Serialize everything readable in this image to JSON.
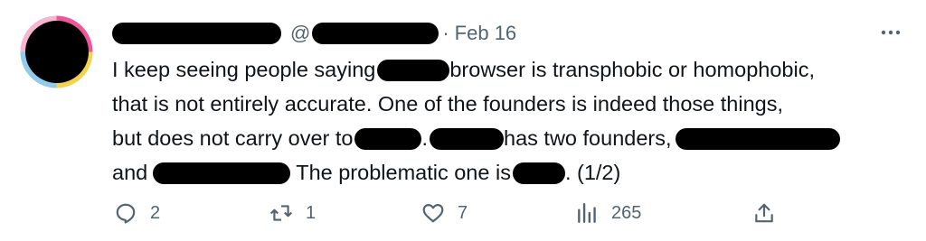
{
  "tweet": {
    "handle_prefix": "@",
    "separator": "·",
    "date": "Feb 16",
    "text": {
      "line1_a": "I keep seeing people saying",
      "line1_b": "browser is transphobic or homophobic,",
      "line2": "that is not entirely accurate. One of the founders is indeed those things,",
      "line3_a": "but does not carry over to",
      "line3_b": ".",
      "line3_c": "has two founders,",
      "line4_a": "and",
      "line4_b": "The problematic one is",
      "line4_c": ". (1/2)"
    }
  },
  "actions": {
    "replies": "2",
    "reposts": "1",
    "likes": "7",
    "views": "265"
  },
  "icons": {
    "more": "more-horizontal-icon",
    "reply": "reply-icon",
    "repost": "repost-icon",
    "like": "heart-icon",
    "views": "views-icon",
    "share": "share-icon"
  },
  "colors": {
    "text": "#0f1419",
    "muted": "#536471",
    "avatar_ring": [
      "#f0559b",
      "#f5d34a",
      "#8ecbef",
      "#f0559b"
    ]
  }
}
